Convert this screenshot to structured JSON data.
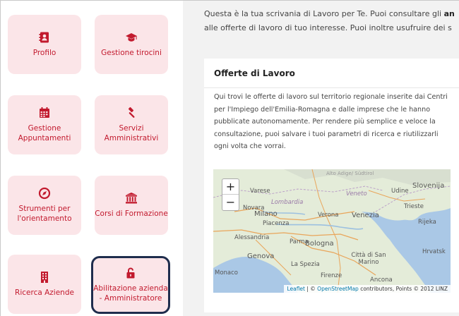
{
  "sidebar": {
    "tiles": [
      {
        "label": "Profilo",
        "icon": "address-card-icon"
      },
      {
        "label": "Gestione tirocini",
        "icon": "graduation-cap-icon"
      },
      {
        "label": "Gestione Appuntamenti",
        "icon": "calendar-icon"
      },
      {
        "label": "Servizi Amministrativi",
        "icon": "gavel-icon"
      },
      {
        "label": "Strumenti per l'orientamento",
        "icon": "compass-icon"
      },
      {
        "label": "Corsi di Formazione",
        "icon": "institution-icon"
      },
      {
        "label": "Ricerca Aziende",
        "icon": "building-icon"
      },
      {
        "label": "Abilitazione azienda - Amministratore",
        "icon": "unlock-icon"
      }
    ],
    "accent_color": "#c21a2e",
    "tile_bg": "#fbe5e8",
    "selected_border": "#1f2d4d"
  },
  "main": {
    "intro_line1_pre": "Questa è la tua scrivania di Lavoro per Te. Puoi consultare gli ",
    "intro_line1_bold": "an",
    "intro_line2": "alle offerte di lavoro di tuo interesse. Puoi inoltre usufruire dei s",
    "card": {
      "title": "Offerte di Lavoro",
      "description": "Qui trovi le offerte di lavoro sul territorio regionale inserite dai Centri per l'Impiego dell'Emilia-Romagna e dalle imprese che le hanno pubblicate autonomamente. Per rendere più semplice e veloce la consultazione, puoi salvare i tuoi parametri di ricerca e riutilizzarli ogni volta che vorrai."
    },
    "map": {
      "zoom_in": "+",
      "zoom_out": "−",
      "labels": [
        "Alto Adige/ Südtirol",
        "Varese",
        "Novara",
        "Lombardia",
        "Milano",
        "Veneto",
        "Udine",
        "Slovenija",
        "Trieste",
        "Verona",
        "Venezia",
        "Piacenza",
        "Rijeka",
        "Alessandria",
        "Parma",
        "Bologna",
        "Genova",
        "Città di San Marino",
        "Hrvatsk",
        "La Spezia",
        "Monaco",
        "Firenze",
        "Ancona"
      ],
      "attribution_leaflet": "Leaflet",
      "attribution_sep": " | © ",
      "attribution_osm": "OpenStreetMap",
      "attribution_rest": " contributors, Points © 2012 LINZ"
    }
  }
}
